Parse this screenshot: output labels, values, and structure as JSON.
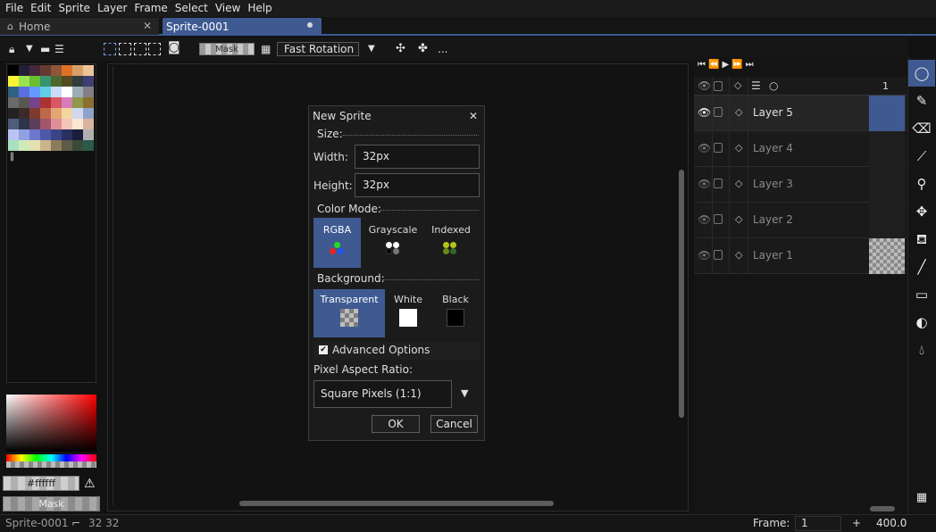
{
  "menu": [
    "File",
    "Edit",
    "Sprite",
    "Layer",
    "Frame",
    "Select",
    "View",
    "Help"
  ],
  "tabs": {
    "home": "Home",
    "sprite": "Sprite-0001"
  },
  "toolbar": {
    "mask_label": "Mask",
    "rotation_algorithm": "Fast Rotation",
    "more": "..."
  },
  "palette": {
    "colors": [
      "#000000",
      "#222034",
      "#45283c",
      "#663931",
      "#8f563b",
      "#df7126",
      "#d9a066",
      "#eec39a",
      "#fbf236",
      "#99e550",
      "#6abe30",
      "#37946e",
      "#4b692f",
      "#524b24",
      "#323c39",
      "#3f3f74",
      "#306082",
      "#5b6ee1",
      "#639bff",
      "#5fcde4",
      "#cbdbfc",
      "#ffffff",
      "#9badb7",
      "#847e87",
      "#696a6a",
      "#595652",
      "#76428a",
      "#ac3232",
      "#d95763",
      "#d77bba",
      "#8f974a",
      "#8a6f30",
      "#222222",
      "#3a2a2a",
      "#7d3b2e",
      "#c0684a",
      "#e4a672",
      "#f1d6a0",
      "#cfd8ef",
      "#8fa2c7",
      "#4f5d7a",
      "#2e3548",
      "#5b3f5a",
      "#a3566b",
      "#de8f95",
      "#f4c6b9",
      "#fbe7cf",
      "#d6b4a0",
      "#b9c4f2",
      "#8fa0e3",
      "#6b78cb",
      "#4d58a8",
      "#3c4486",
      "#2a2f5e",
      "#1b1d3c",
      "#b0b0b0",
      "#a7e0c0",
      "#cfe9b8",
      "#e4e0b0",
      "#c9b48c",
      "#8c7a5a",
      "#5d5a48",
      "#3a4a3a",
      "#2d5a4a"
    ]
  },
  "color": {
    "hex": "#ffffff",
    "mask_label": "Mask"
  },
  "dialog": {
    "title": "New Sprite",
    "size_label": "Size:",
    "width_label": "Width:",
    "width_value": "32px",
    "height_label": "Height:",
    "height_value": "32px",
    "color_mode_label": "Color Mode:",
    "color_modes": [
      "RGBA",
      "Grayscale",
      "Indexed"
    ],
    "selected_color_mode": "RGBA",
    "background_label": "Background:",
    "backgrounds": [
      "Transparent",
      "White",
      "Black"
    ],
    "selected_background": "Transparent",
    "advanced_label": "Advanced Options",
    "advanced_checked": true,
    "pixel_ratio_label": "Pixel Aspect Ratio:",
    "pixel_ratio_value": "Square Pixels (1:1)",
    "ok": "OK",
    "cancel": "Cancel"
  },
  "timeline": {
    "frame_header": "1",
    "layers": [
      "Layer 5",
      "Layer 4",
      "Layer 3",
      "Layer 2",
      "Layer 1"
    ],
    "active_layer": "Layer 5"
  },
  "status": {
    "sprite_name": "Sprite-0001",
    "size": "32 32",
    "frame_label": "Frame:",
    "frame_value": "1",
    "zoom": "400.0"
  }
}
